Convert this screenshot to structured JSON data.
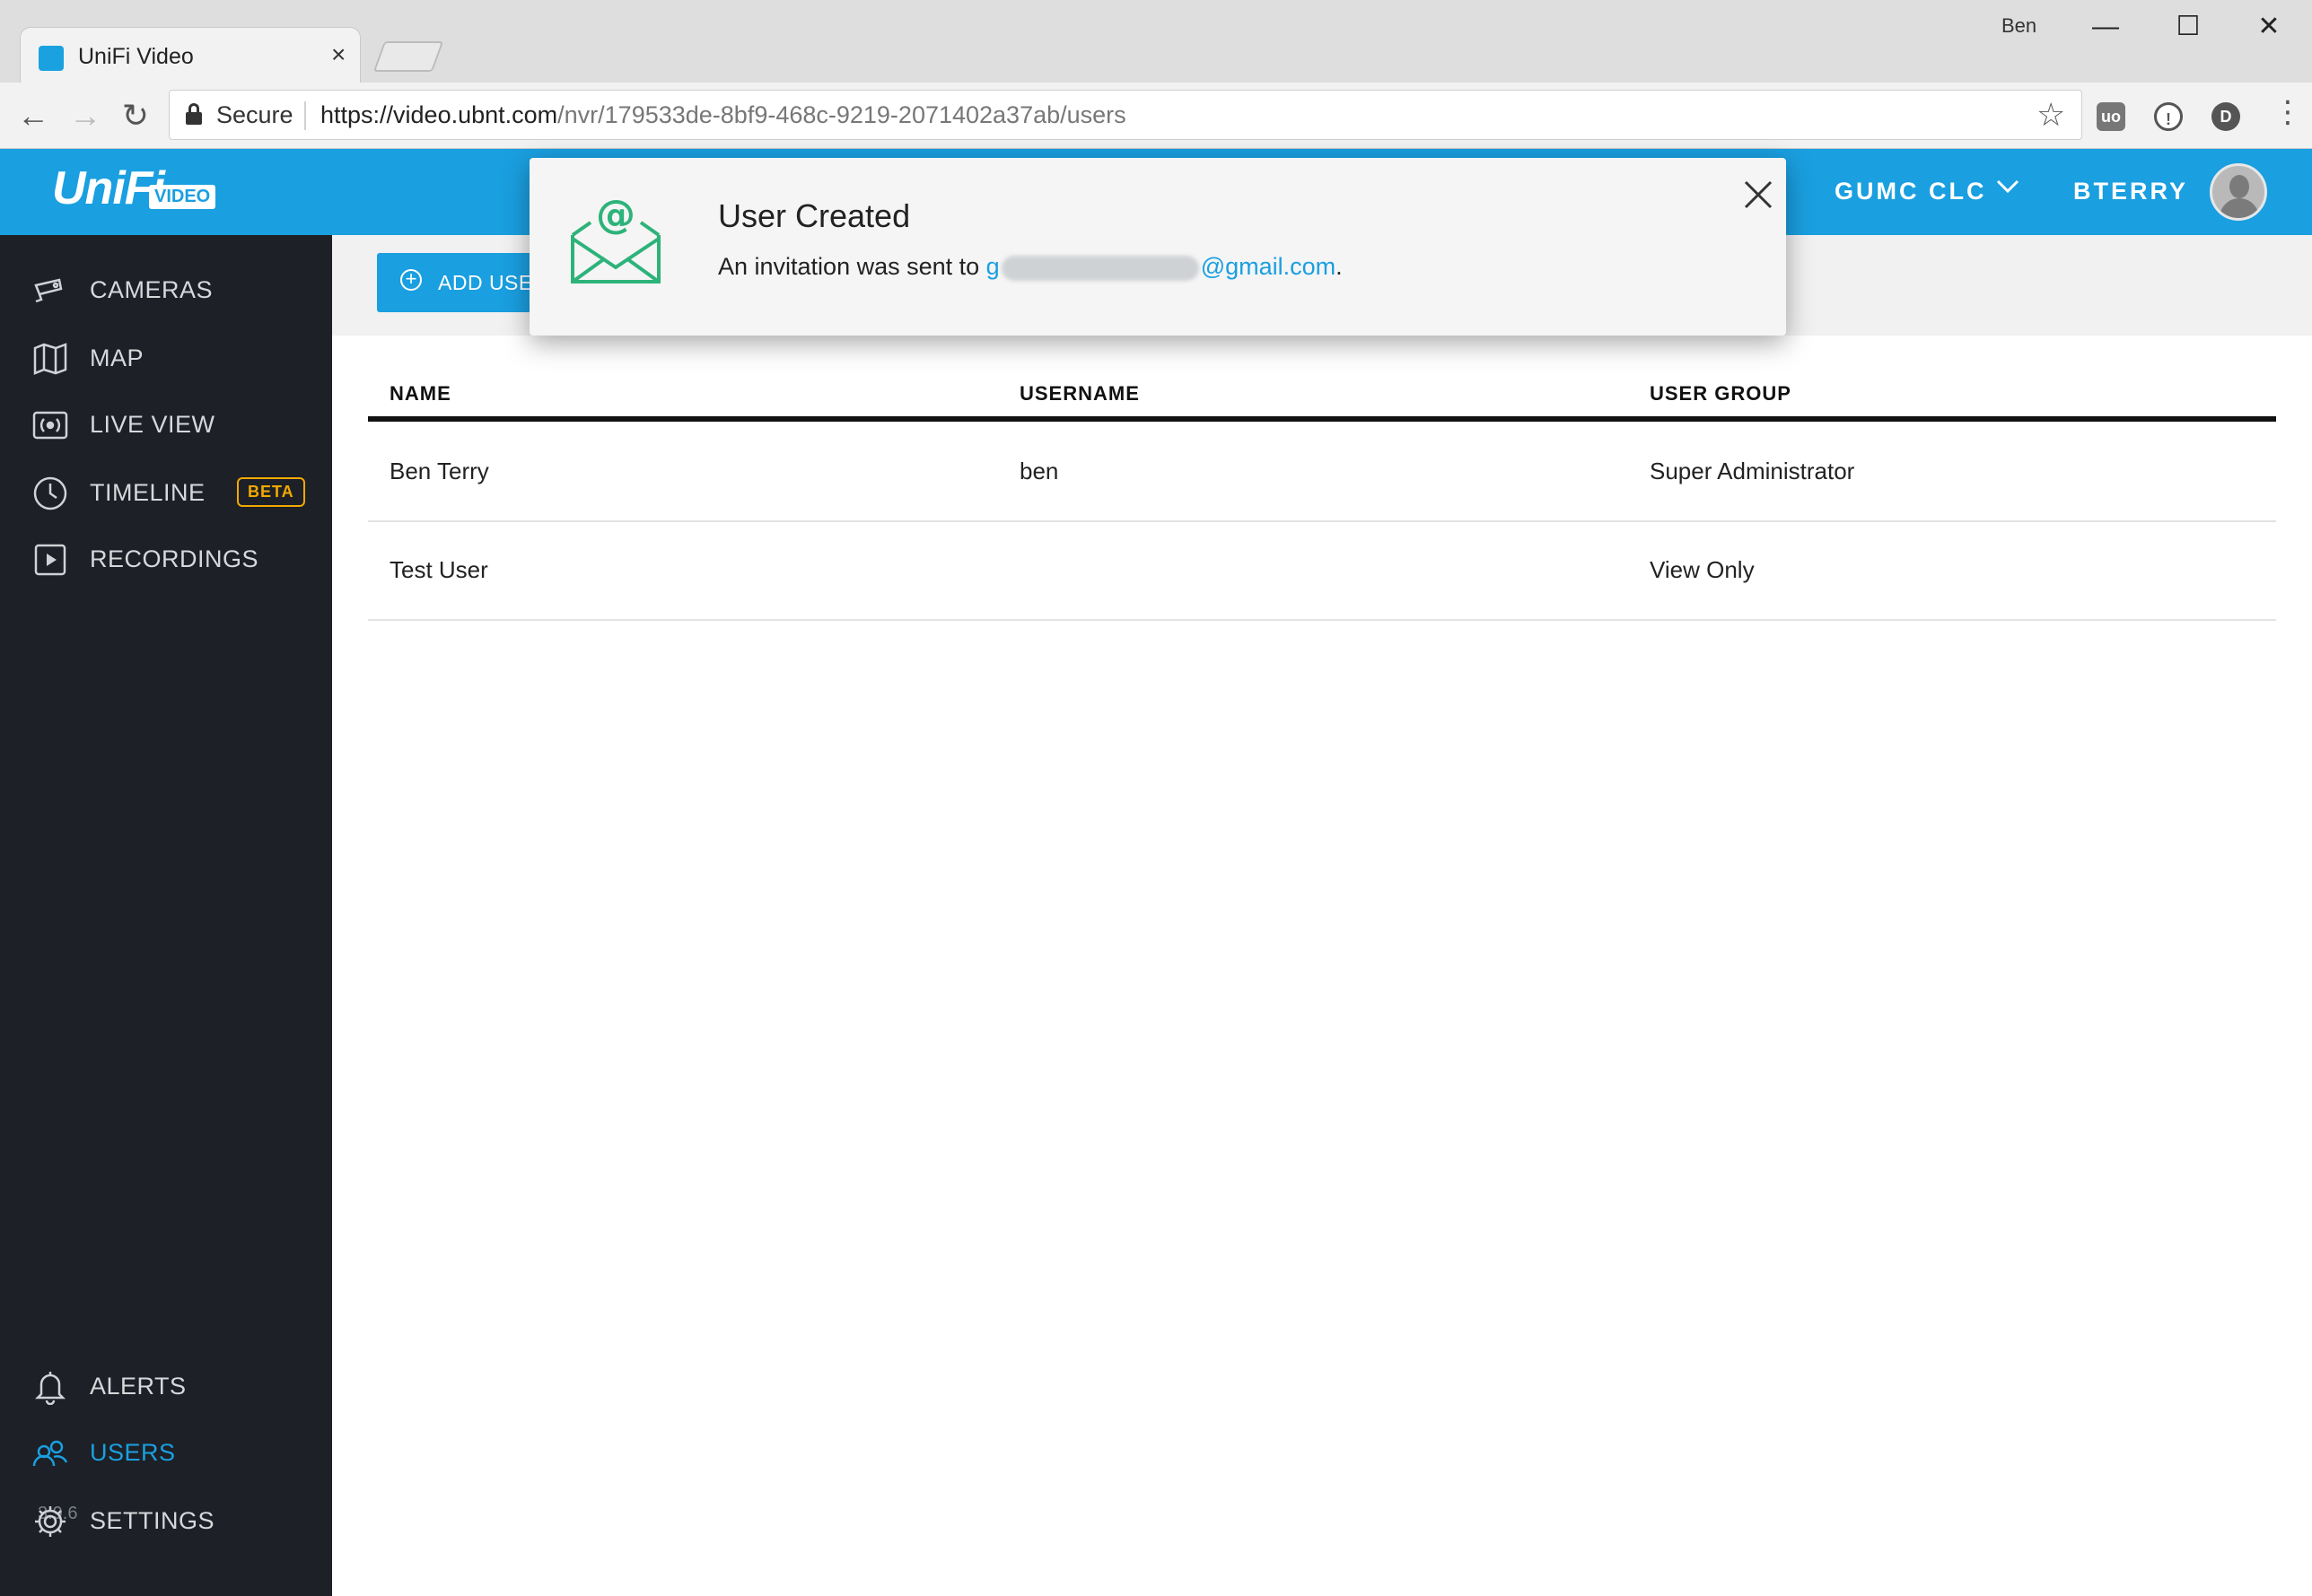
{
  "browser": {
    "tab_title": "UniFi Video",
    "tab_close": "×",
    "window_user": "Ben",
    "window_controls": {
      "minimize": "—",
      "maximize": "☐",
      "close": "✕"
    },
    "secure_label": "Secure",
    "url_host": "https://video.ubnt.com",
    "url_path": "/nvr/179533de-8bf9-468c-9219-2071402a37ab/users",
    "extensions": [
      "uo",
      "!",
      "D"
    ]
  },
  "header": {
    "logo_text": "UniFi",
    "logo_badge": "VIDEO",
    "site_name": "GUMC CLC",
    "user_name": "BTERRY"
  },
  "sidebar": {
    "items": [
      {
        "label": "CAMERAS",
        "icon": "camera-icon"
      },
      {
        "label": "MAP",
        "icon": "map-icon"
      },
      {
        "label": "LIVE VIEW",
        "icon": "live-view-icon"
      },
      {
        "label": "TIMELINE",
        "icon": "clock-icon",
        "badge": "BETA"
      },
      {
        "label": "RECORDINGS",
        "icon": "play-icon"
      }
    ],
    "version": "3.9.6",
    "bottom_items": [
      {
        "label": "ALERTS",
        "icon": "bell-icon"
      },
      {
        "label": "USERS",
        "icon": "users-icon",
        "active": true
      },
      {
        "label": "SETTINGS",
        "icon": "gear-icon"
      }
    ]
  },
  "actions": {
    "add_user": "ADD USER"
  },
  "table": {
    "columns": [
      "NAME",
      "USERNAME",
      "USER GROUP"
    ],
    "rows": [
      {
        "name": "Ben Terry",
        "username": "ben",
        "group": "Super Administrator"
      },
      {
        "name": "Test User",
        "username": "",
        "group": "View Only"
      }
    ]
  },
  "toast": {
    "title": "User Created",
    "message_prefix": "An invitation was sent to ",
    "email_start": "g",
    "email_end": "@gmail.com",
    "message_suffix": "."
  },
  "colors": {
    "accent": "#1a9fe0",
    "sidebar": "#1d2026",
    "beta": "#f2a900",
    "mail_icon": "#2db37a"
  }
}
